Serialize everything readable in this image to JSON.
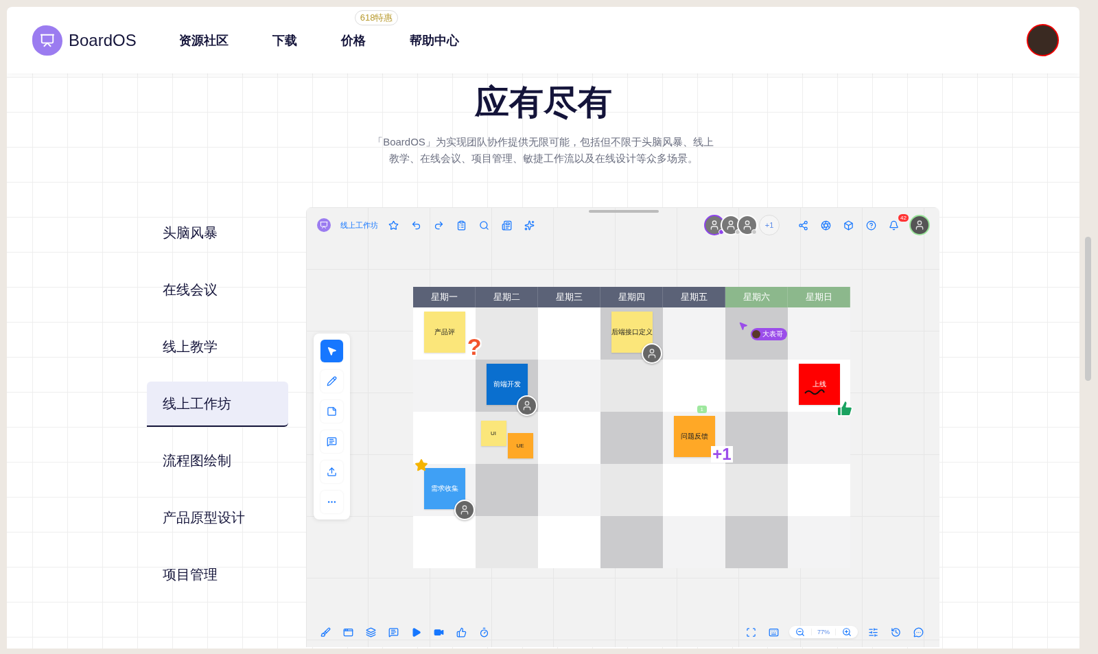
{
  "header": {
    "brand": "BoardOS",
    "nav": [
      {
        "label": "资源社区"
      },
      {
        "label": "下载"
      },
      {
        "label": "价格",
        "badge": "618特惠"
      },
      {
        "label": "帮助中心"
      }
    ]
  },
  "hero": {
    "title": "应有尽有",
    "description": "「BoardOS」为实现团队协作提供无限可能，包括但不限于头脑风暴、线上教学、在线会议、项目管理、敏捷工作流以及在线设计等众多场景。"
  },
  "scenarios": [
    {
      "label": "头脑风暴",
      "selected": false
    },
    {
      "label": "在线会议",
      "selected": false
    },
    {
      "label": "线上教学",
      "selected": false
    },
    {
      "label": "线上工作坊",
      "selected": true
    },
    {
      "label": "流程图绘制",
      "selected": false
    },
    {
      "label": "产品原型设计",
      "selected": false
    },
    {
      "label": "项目管理",
      "selected": false
    }
  ],
  "board": {
    "title": "线上工作坊",
    "collaborators": [
      {
        "color": "#8e44ec"
      },
      {
        "color": "#c8c8c8"
      },
      {
        "color": "#c8c8c8"
      }
    ],
    "more_collaborators": "+1",
    "notifications": "42",
    "zoom": "77%",
    "tools": [
      {
        "kind": "select",
        "selected": true
      },
      {
        "kind": "pen",
        "selected": false
      },
      {
        "kind": "sticky",
        "selected": false
      },
      {
        "kind": "comment",
        "selected": false
      },
      {
        "kind": "upload",
        "selected": false
      },
      {
        "kind": "more",
        "selected": false
      }
    ],
    "columns": [
      {
        "label": "星期一",
        "color": "#5b6277"
      },
      {
        "label": "星期二",
        "color": "#5b6277"
      },
      {
        "label": "星期三",
        "color": "#5b6277"
      },
      {
        "label": "星期四",
        "color": "#5b6277"
      },
      {
        "label": "星期五",
        "color": "#5b6277"
      },
      {
        "label": "星期六",
        "color": "#8cb88c"
      },
      {
        "label": "星期日",
        "color": "#8cb88c"
      }
    ],
    "rows": [
      {
        "cells": [
          {
            "notes": [
              {
                "text": "产品评",
                "color": "#fbe67a",
                "sticker": {
                  "kind": "question",
                  "text": "?"
                }
              }
            ]
          },
          {},
          {},
          {
            "notes": [
              {
                "text": "后端接口定义",
                "color": "#fbe67a",
                "avatar": true
              }
            ]
          },
          {},
          {
            "cursor": {
              "name": "大表哥",
              "color": "#9b4dea"
            }
          },
          {}
        ]
      },
      {
        "cells": [
          {},
          {
            "notes": [
              {
                "text": "前端开发",
                "color": "#0a6fcf",
                "avatar": true
              }
            ]
          },
          {},
          {},
          {},
          {},
          {
            "notes": [
              {
                "text": "上线",
                "color": "#ff0000",
                "sticker": {
                  "kind": "thumb"
                }
              }
            ]
          }
        ]
      },
      {
        "cells": [
          {},
          {
            "notes": [
              {
                "text": "UI",
                "color": "#fbe67a"
              },
              {
                "text": "UE",
                "color": "#ffa826"
              }
            ]
          },
          {},
          {},
          {
            "notes": [
              {
                "text": "问题反馈",
                "color": "#ffa826",
                "comments": "1",
                "sticker": {
                  "kind": "plus",
                  "text": "+1"
                }
              }
            ]
          },
          {},
          {}
        ]
      },
      {
        "cells": [
          {
            "notes": [
              {
                "text": "需求收集",
                "color": "#3fa0f5",
                "avatar": true,
                "sticker": {
                  "kind": "star"
                }
              }
            ]
          },
          {},
          {},
          {},
          {},
          {},
          {}
        ]
      },
      {
        "cells": [
          {},
          {},
          {},
          {},
          {},
          {},
          {}
        ]
      }
    ]
  }
}
